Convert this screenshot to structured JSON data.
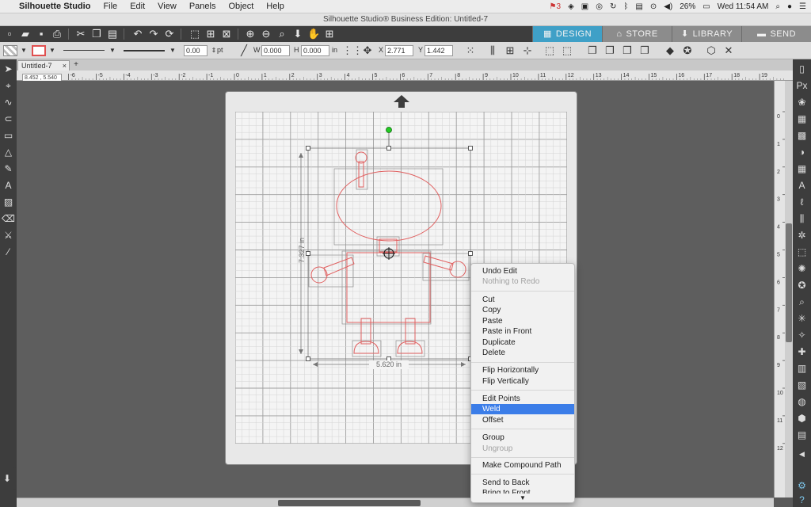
{
  "menubar": {
    "app": "Silhouette Studio",
    "items": [
      "File",
      "Edit",
      "View",
      "Panels",
      "Object",
      "Help"
    ],
    "notification_count": "3",
    "battery": "26%",
    "clock": "Wed 11:54 AM"
  },
  "window": {
    "title": "Silhouette Studio® Business Edition: Untitled-7"
  },
  "nav_tabs": [
    {
      "label": "DESIGN",
      "icon": "grid-icon",
      "active": true
    },
    {
      "label": "STORE",
      "icon": "storefront-icon",
      "active": false
    },
    {
      "label": "LIBRARY",
      "icon": "download-library-icon",
      "active": false
    },
    {
      "label": "SEND",
      "icon": "cutter-icon",
      "active": false
    }
  ],
  "line_toolbar": {
    "line_width": "0.00",
    "line_width_unit": "pt"
  },
  "size_toolbar": {
    "w_label": "W",
    "w_value": "0.000",
    "h_label": "H",
    "h_value": "0.000",
    "unit": "in",
    "x_label": "X",
    "x_value": "2.771",
    "y_label": "Y",
    "y_value": "1.442"
  },
  "document": {
    "tab_name": "Untitled-7",
    "tab_close": "×",
    "add_tab": "+",
    "cursor_coords": "8.452 , 5.540"
  },
  "ruler": {
    "h_ticks": [
      "-6",
      "-5",
      "-4",
      "-3",
      "-2",
      "-1",
      "0",
      "1",
      "2",
      "3",
      "4",
      "5",
      "6",
      "7",
      "8",
      "9",
      "10",
      "11",
      "12",
      "13",
      "14",
      "15",
      "16",
      "17",
      "18",
      "19"
    ],
    "v_ticks": [
      "0",
      "1",
      "2",
      "3",
      "4",
      "5",
      "6",
      "7",
      "8",
      "9",
      "10",
      "11",
      "12"
    ]
  },
  "selection": {
    "height_label": "7.327 in",
    "width_label": "5.620 in"
  },
  "context_menu": {
    "items": [
      {
        "label": "Undo Edit",
        "disabled": false
      },
      {
        "label": "Nothing to Redo",
        "disabled": true
      },
      {
        "label": "Cut",
        "disabled": false
      },
      {
        "label": "Copy",
        "disabled": false
      },
      {
        "label": "Paste",
        "disabled": false
      },
      {
        "label": "Paste in Front",
        "disabled": false
      },
      {
        "label": "Duplicate",
        "disabled": false
      },
      {
        "label": "Delete",
        "disabled": false
      },
      {
        "label": "Flip Horizontally",
        "disabled": false
      },
      {
        "label": "Flip Vertically",
        "disabled": false
      },
      {
        "label": "Edit Points",
        "disabled": false
      },
      {
        "label": "Weld",
        "disabled": false,
        "selected": true
      },
      {
        "label": "Offset",
        "disabled": false
      },
      {
        "label": "Group",
        "disabled": false
      },
      {
        "label": "Ungroup",
        "disabled": true
      },
      {
        "label": "Make Compound Path",
        "disabled": false
      },
      {
        "label": "Send to Back",
        "disabled": false
      },
      {
        "label": "Bring to Front",
        "disabled": false
      }
    ],
    "more_arrow": "▼"
  },
  "colors": {
    "accent_design_tab": "#3fa0c7",
    "menu_highlight": "#3b7de8",
    "shape_stroke": "#e06060",
    "rotate_handle": "#22cc22"
  }
}
